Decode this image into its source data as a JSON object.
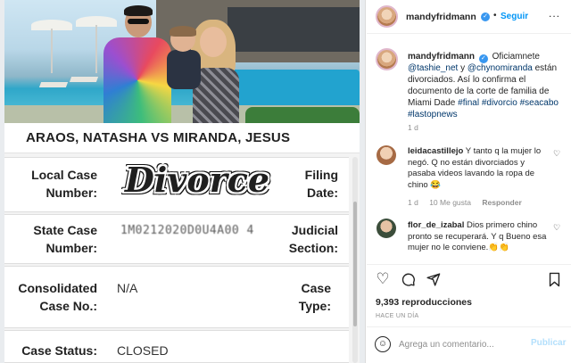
{
  "document": {
    "case_title": "ARAOS, NATASHA VS MIRANDA, JESUS",
    "local_case_label_1": "Local Case",
    "local_case_label_2": "Number:",
    "overlay_text": "Divorce",
    "filing_label_1": "Filing",
    "filing_label_2": "Date:",
    "state_case_label_1": "State Case",
    "state_case_label_2": "Number:",
    "state_case_value": "1M0212020D0U4A00 4",
    "judicial_label_1": "Judicial",
    "judicial_label_2": "Section:",
    "consolidated_label_1": "Consolidated",
    "consolidated_label_2": "Case No.:",
    "consolidated_value": "N/A",
    "case_type_label_1": "Case",
    "case_type_label_2": "Type:",
    "status_label": "Case Status:",
    "status_value": "CLOSED"
  },
  "header": {
    "username": "mandyfridmann",
    "separator": "•",
    "follow_label": "Seguir",
    "more_label": "..."
  },
  "caption": {
    "username": "mandyfridmann",
    "text_1": "Oficiamnete",
    "mention_1": "@tashie_net",
    "text_2": "y",
    "mention_2": "@chynomiranda",
    "text_3": "están divorciados. Así lo confirma el documento de la corte de familia de Miami Dade",
    "hashtags": "#final #divorcio #seacabo #lastopnews",
    "time": "1 d"
  },
  "comments": [
    {
      "username": "leidacastillejo",
      "text": "Y tanto q la mujer lo negó. Q no están divorciados y pasaba videos lavando la ropa de chino 😂",
      "time": "1 d",
      "likes": "10 Me gusta",
      "reply_label": "Responder"
    },
    {
      "username": "flor_de_izabal",
      "text": "Dios primero chino pronto se recuperará. Y q Bueno esa mujer no le conviene.👏👏"
    }
  ],
  "stats": {
    "views": "9,393 reproducciones",
    "posted": "HACE UN DÍA"
  },
  "comment_box": {
    "placeholder": "Agrega un comentario...",
    "post_label": "Publicar"
  }
}
